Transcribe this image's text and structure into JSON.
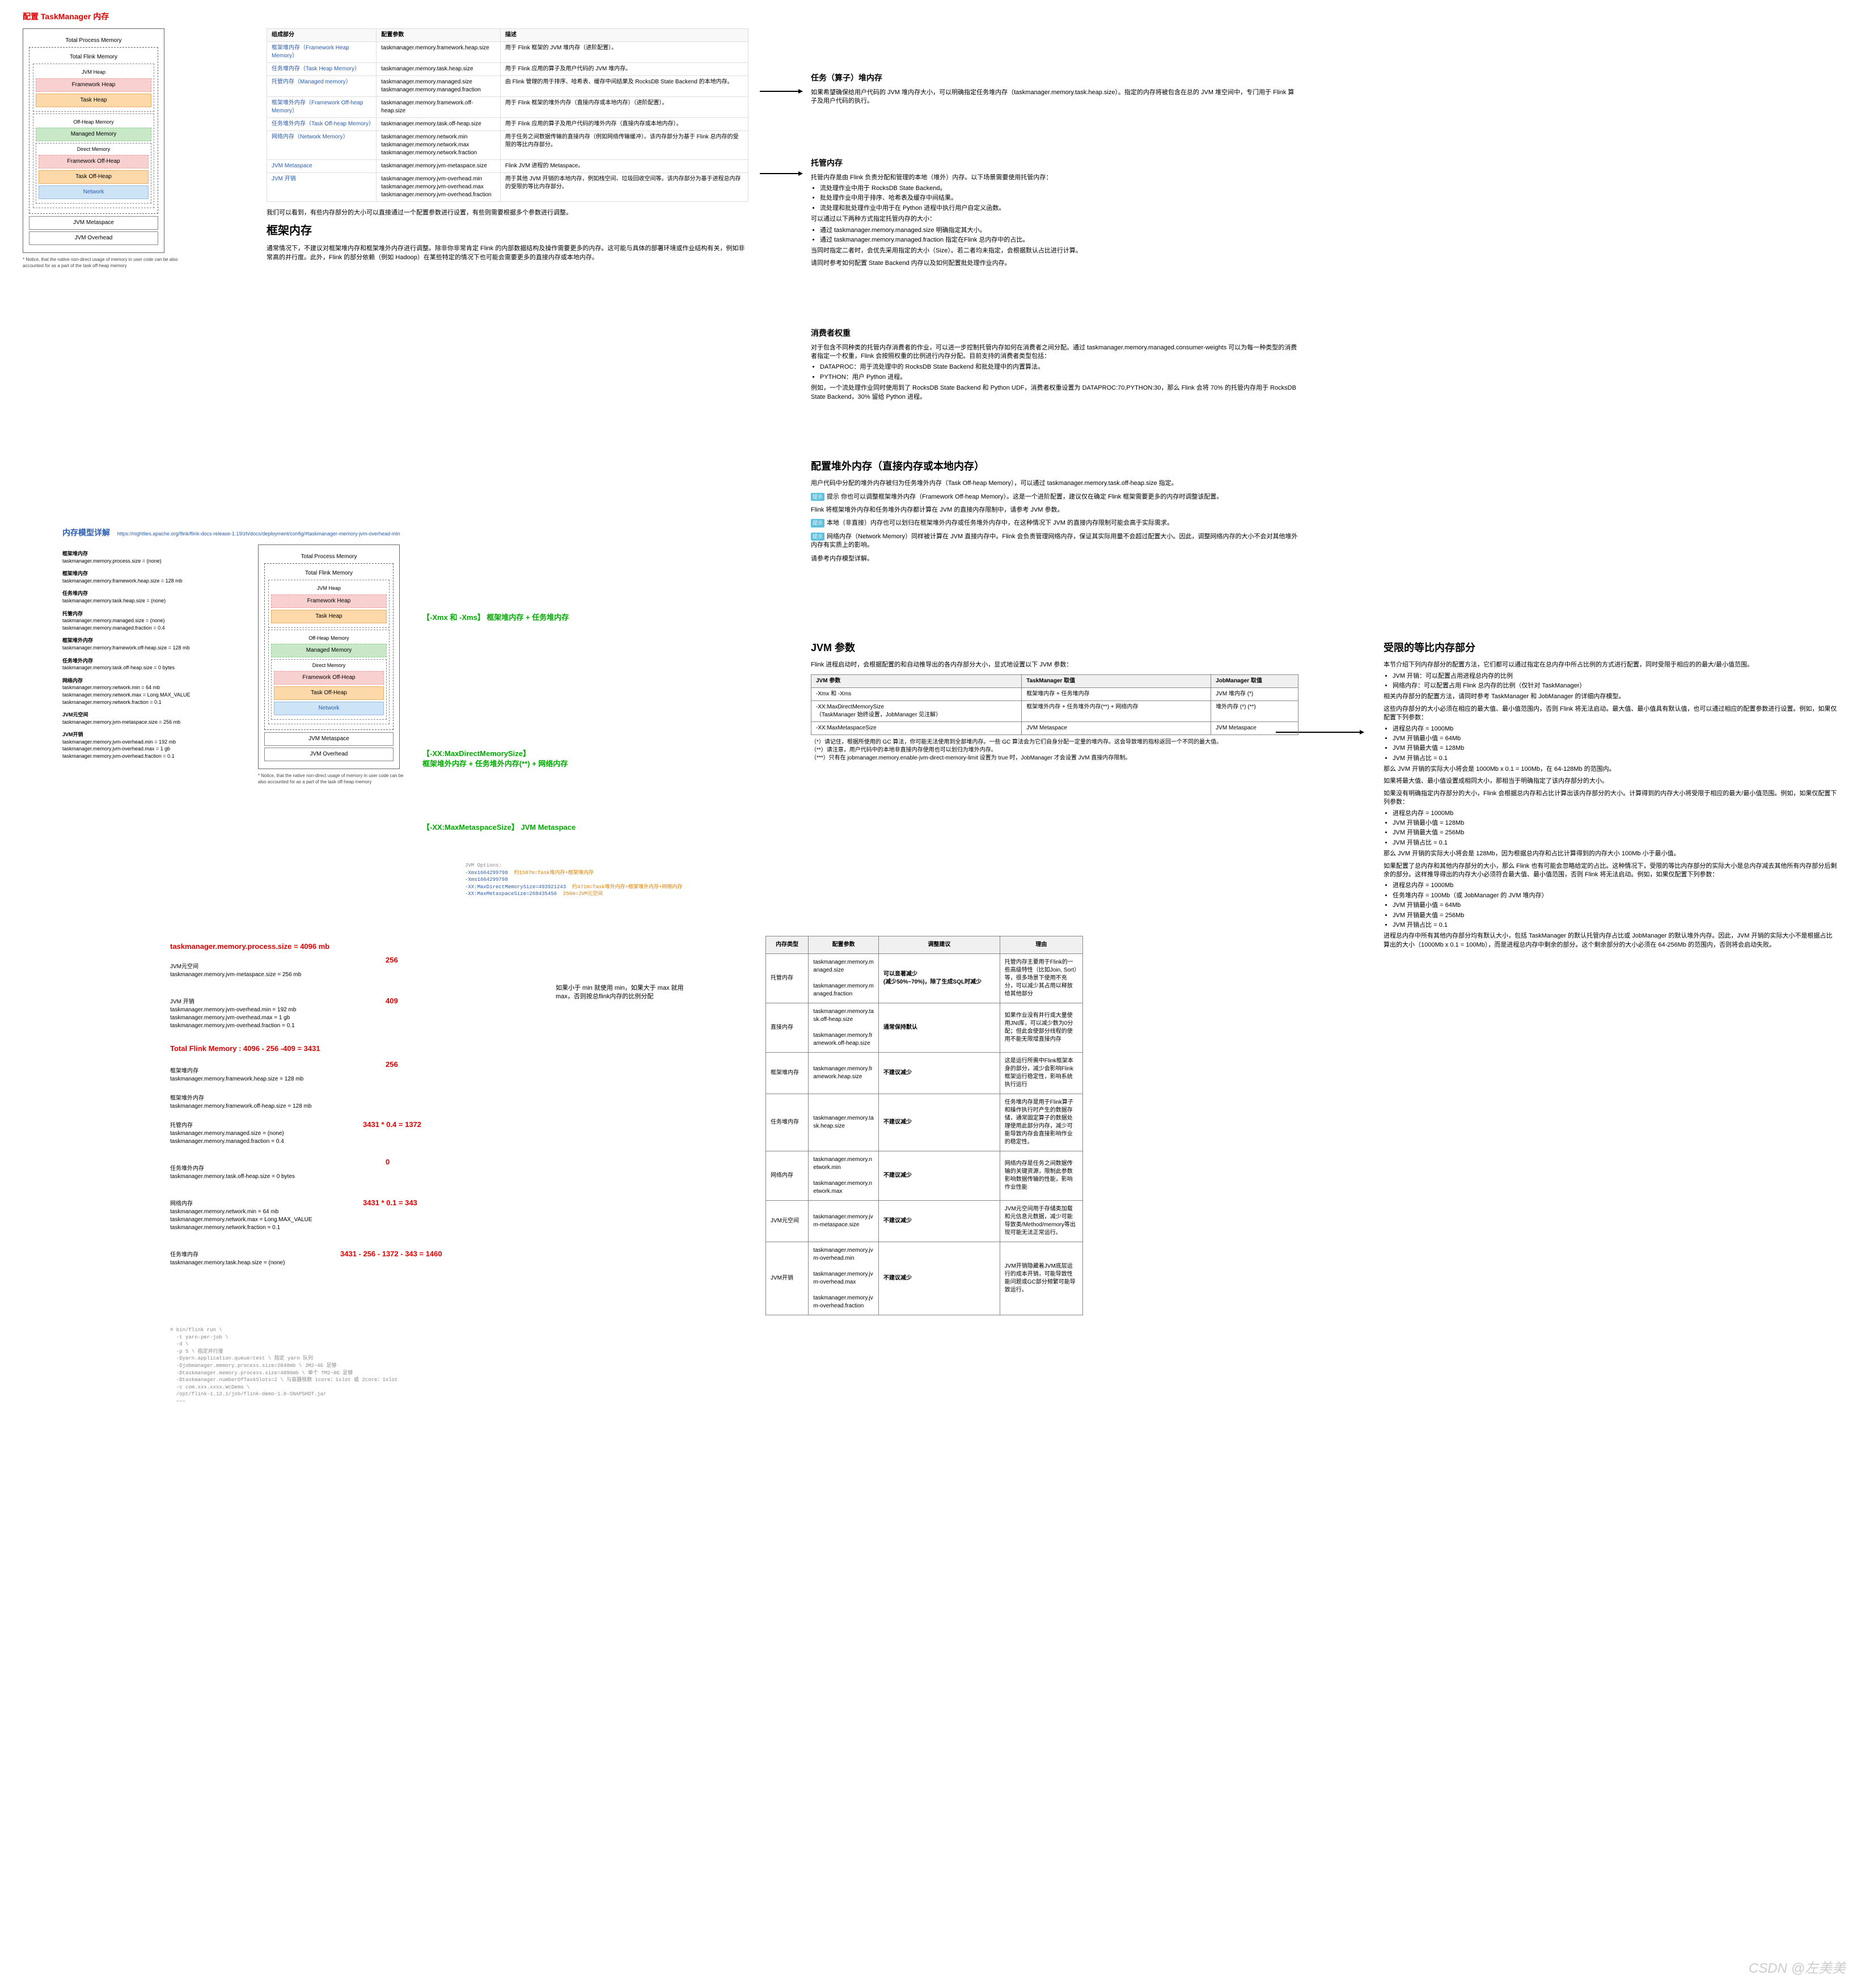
{
  "title": "配置 TaskManager 内存",
  "memdiagram": {
    "title": "Total Process Memory",
    "inner": "Total Flink Memory",
    "jvmheap_group": "JVM Heap",
    "fw_heap": "Framework Heap",
    "task_heap": "Task Heap",
    "offheap_group": "Off-Heap Memory",
    "managed": "Managed Memory",
    "direct_group": "Direct Memory",
    "fw_off": "Framework Off-Heap",
    "task_off": "Task Off-Heap",
    "network": "Network",
    "metaspace": "JVM Metaspace",
    "overhead": "JVM Overhead",
    "note": "* Notice, that the native non-direct usage of memory in user code can be also accounted for as a part of the task off-heap memory"
  },
  "table1": {
    "h1": "组成部分",
    "h2": "配置参数",
    "h3": "描述",
    "rows": [
      {
        "c1": "框架堆内存（Framework Heap Memory）",
        "c2": "taskmanager.memory.framework.heap.size",
        "c3": "用于 Flink 框架的 JVM 堆内存（进阶配置）。"
      },
      {
        "c1": "任务堆内存（Task Heap Memory）",
        "c2": "taskmanager.memory.task.heap.size",
        "c3": "用于 Flink 应用的算子及用户代码的 JVM 堆内存。"
      },
      {
        "c1": "托管内存（Managed memory）",
        "c2": "taskmanager.memory.managed.size\ntaskmanager.memory.managed.fraction",
        "c3": "由 Flink 管理的用于排序、哈希表、缓存中间结果及 RocksDB State Backend 的本地内存。"
      },
      {
        "c1": "框架堆外内存（Framework Off-heap Memory）",
        "c2": "taskmanager.memory.framework.off-heap.size",
        "c3": "用于 Flink 框架的堆外内存（直接内存或本地内存）（进阶配置）。"
      },
      {
        "c1": "任务堆外内存（Task Off-heap Memory）",
        "c2": "taskmanager.memory.task.off-heap.size",
        "c3": "用于 Flink 应用的算子及用户代码的堆外内存（直接内存或本地内存）。"
      },
      {
        "c1": "网络内存（Network Memory）",
        "c2": "taskmanager.memory.network.min\ntaskmanager.memory.network.max\ntaskmanager.memory.network.fraction",
        "c3": "用于任务之间数据传输的直接内存（例如网络传输缓冲）。该内存部分为基于 Flink 总内存的受限的等比内存部分。"
      },
      {
        "c1": "JVM Metaspace",
        "c2": "taskmanager.memory.jvm-metaspace.size",
        "c3": "Flink JVM 进程的 Metaspace。"
      },
      {
        "c1": "JVM 开销",
        "c2": "taskmanager.memory.jvm-overhead.min\ntaskmanager.memory.jvm-overhead.max\ntaskmanager.memory.jvm-overhead.fraction",
        "c3": "用于其他 JVM 开销的本地内存，例如栈空间、垃圾回收空间等。该内存部分为基于进程总内存的受限的等比内存部分。"
      }
    ],
    "footer": "我们可以看到，有些内存部分的大小可以直接通过一个配置参数进行设置，有些则需要根据多个参数进行调整。"
  },
  "framework_mem": {
    "title": "框架内存",
    "p1": "通常情况下，不建议对框架堆内存和框架堆外内存进行调整。除非你非常肯定 Flink 的内部数据结构及操作需要更多的内存。这可能与具体的部署环境或作业结构有关，例如非常高的并行度。此外，Flink 的部分依赖（例如 Hadoop）在某些特定的情况下也可能会需要更多的直接内存或本地内存。"
  },
  "task_heap": {
    "title": "任务（算子）堆内存",
    "p1": "如果希望确保给用户代码的 JVM 堆内存大小，可以明确指定任务堆内存（taskmanager.memory.task.heap.size）。指定的内存将被包含在总的 JVM 堆空间中，专门用于 Flink 算子及用户代码的执行。"
  },
  "managed": {
    "title": "托管内存",
    "p1": "托管内存是由 Flink 负责分配和管理的本地（堆外）内存。以下场景需要使用托管内存：",
    "b1": "流处理作业中用于 RocksDB State Backend。",
    "b2": "批处理作业中用于排序、哈希表及缓存中间结果。",
    "b3": "流处理和批处理作业中用于在 Python 进程中执行用户自定义函数。",
    "p2": "可以通过以下两种方式指定托管内存的大小：",
    "b4": "通过 taskmanager.memory.managed.size 明确指定其大小。",
    "b5": "通过 taskmanager.memory.managed.fraction 指定在Flink 总内存中的占比。",
    "p3": "当同时指定二者时，会优先采用指定的大小（Size）。若二者均未指定，会根据默认占比进行计算。",
    "p4": "请同时参考如何配置 State Backend 内存以及如何配置批处理作业内存。"
  },
  "consumer": {
    "title": "消费者权重",
    "p1": "对于包含不同种类的托管内存消费者的作业，可以进一步控制托管内存如何在消费者之间分配。通过 taskmanager.memory.managed.consumer-weights 可以为每一种类型的消费者指定一个权重，Flink 会按照权重的比例进行内存分配。目前支持的消费者类型包括：",
    "b1": "DATAPROC：用于流处理中的 RocksDB State Backend 和批处理中的内置算法。",
    "b2": "PYTHON：用户 Python 进程。",
    "p2": "例如，一个流处理作业同时使用到了 RocksDB State Backend 和 Python UDF，消费者权重设置为 DATAPROC:70,PYTHON:30，那么 Flink 会将 70% 的托管内存用于 RocksDB State Backend，30% 留给 Python 进程。"
  },
  "offheap_conf": {
    "title": "配置堆外内存（直接内存或本地内存）",
    "p1": "用户代码中分配的堆外内存被归为任务堆外内存（Task Off-heap Memory），可以通过 taskmanager.memory.task.off-heap.size 指定。",
    "p2": "提示 你也可以调整框架堆外内存（Framework Off-heap Memory）。这是一个进阶配置，建议仅在确定 Flink 框架需要更多的内存时调整该配置。",
    "p3": "Flink 将框架堆外内存和任务堆外内存都计算在 JVM 的直接内存限制中，请参考 JVM 参数。",
    "n1": "本地（非直接）内存也可以划归在框架堆外内存或任务堆外内存中，在这种情况下 JVM 的直接内存限制可能会高于实际需求。",
    "n2": "网络内存（Network Memory）同样被计算在 JVM 直接内存中。Flink 会负责管理网络内存，保证其实际用量不会超过配置大小。因此，调整网络内存的大小不会对其他堆外内存有实质上的影响。",
    "p4": "请参考内存模型详解。"
  },
  "jvm_params": {
    "title": "JVM 参数",
    "p1": "Flink 进程启动时，会根据配置的和自动推导出的各内存部分大小，显式地设置以下 JVM 参数：",
    "th1": "JVM 参数",
    "th2": "TaskManager 取值",
    "th3": "JobManager 取值",
    "r1": {
      "a": "-Xmx 和 -Xms",
      "b": "框架堆内存 + 任务堆内存",
      "c": "JVM 堆内存 (*)"
    },
    "r2": {
      "a": "-XX:MaxDirectMemorySize\n（TaskManager 始终设置，JobManager 见注解）",
      "b": "框架堆外内存 + 任务堆外内存(**) + 网络内存",
      "c": "堆外内存 (*) (**)"
    },
    "r3": {
      "a": "-XX:MaxMetaspaceSize",
      "b": "JVM Metaspace",
      "c": "JVM Metaspace"
    },
    "f1": "（*）请记住，根据所使用的 GC 算法，你可能无法使用到全部堆内存。一些 GC 算法会为它们自身分配一定量的堆内存。这会导致堆的指标返回一个不同的最大值。",
    "f2": "（**）请注意，用户代码中的本地非直接内存使用也可以划归为堆外内存。",
    "f3": "（***）只有在 jobmanager.memory.enable-jvm-direct-memory-limit 设置为 true 时，JobManager 才会设置 JVM 直接内存限制。"
  },
  "limited": {
    "title": "受限的等比内存部分",
    "p1": "本节介绍下列内存部分的配置方法，它们都可以通过指定在总内存中所占比例的方式进行配置，同时受限于相应的的最大/最小值范围。",
    "b1": "JVM 开销：可以配置占用进程总内存的比例",
    "b2": "网络内存：可以配置占用 Flink 总内存的比例（仅针对 TaskManager）",
    "p2": "相关内存部分的配置方法，请同时参考 TaskManager 和 JobManager 的详细内存模型。",
    "p3": "这些内存部分的大小必须在相应的最大值、最小值范围内，否则 Flink 将无法启动。最大值、最小值具有默认值，也可以通过相应的配置参数进行设置。例如，如果仅配置下列参数：",
    "e1_1": "进程总内存 = 1000Mb",
    "e1_2": "JVM 开销最小值 = 64Mb",
    "e1_3": "JVM 开销最大值 = 128Mb",
    "e1_4": "JVM 开销占比 = 0.1",
    "p4": "那么 JVM 开销的实际大小将会是 1000Mb x 0.1 = 100Mb，在 64-128Mb 的范围内。",
    "p5": "如果将最大值、最小值设置成相同大小，那相当于明确指定了该内存部分的大小。",
    "p6": "如果没有明确指定内存部分的大小，Flink 会根据总内存和占比计算出该内存部分的大小。计算得到的内存大小将受限于相应的最大/最小值范围。例如，如果仅配置下列参数：",
    "e2_1": "进程总内存 = 1000Mb",
    "e2_2": "JVM 开销最小值 = 128Mb",
    "e2_3": "JVM 开销最大值 = 256Mb",
    "e2_4": "JVM 开销占比 = 0.1",
    "p7": "那么 JVM 开销的实际大小将会是 128Mb，因为根据总内存和占比计算得到的内存大小 100Mb 小于最小值。",
    "p8": "如果配置了总内存和其他内存部分的大小，那么 Flink 也有可能会忽略给定的占比。这种情况下，受限的等比内存部分的实际大小是总内存减去其他所有内存部分后剩余的部分。这样推导得出的内存大小必须符合最大值、最小值范围，否则 Flink 将无法启动。例如，如果仅配置下列参数：",
    "e3_1": "进程总内存 = 1000Mb",
    "e3_2": "任务堆内存 = 100Mb（或 JobManager 的 JVM 堆内存）",
    "e3_3": "JVM 开销最小值 = 64Mb",
    "e3_4": "JVM 开销最大值 = 256Mb",
    "e3_5": "JVM 开销占比 = 0.1",
    "p9": "进程总内存中所有其他内存部分均有默认大小，包括 TaskManager 的默认托管内存占比或 JobManager 的默认堆外内存。因此，JVM 开销的实际大小不是根据占比算出的大小（1000Mb x 0.1 = 100Mb），而是进程总内存中剩余的部分。这个剩余部分的大小必须在 64-256Mb 的范围内，否则将会启动失败。"
  },
  "model_detail": {
    "title": "内存模型详解",
    "url": "https://nightlies.apache.org/flink/flink-docs-release-1.19/zh/docs/deployment/config/#taskmanager-memory-jvm-overhead-min",
    "s1": {
      "t": "框架堆内存",
      "v": "taskmanager.memory.process.size = (none)"
    },
    "s2": {
      "t": "框架堆内存",
      "v": "taskmanager.memory.framework.heap.size = 128 mb"
    },
    "s3": {
      "t": "任务堆内存",
      "v": "taskmanager.memory.task.heap.size = (none)"
    },
    "s4": {
      "t": "托管内存",
      "v": "taskmanager.memory.managed.size = (none)\ntaskmanager.memory.managed.fraction = 0.4"
    },
    "s5": {
      "t": "框架堆外内存",
      "v": "taskmanager.memory.framework.off-heap.size = 128 mb"
    },
    "s6": {
      "t": "任务堆外内存",
      "v": "taskmanager.memory.task.off-heap.size = 0 bytes"
    },
    "s7": {
      "t": "网络内存",
      "v": "taskmanager.memory.network.min = 64 mb\ntaskmanager.memory.network.max = Long.MAX_VALUE\ntaskmanager.memory.network.fraction = 0.1"
    },
    "s8": {
      "t": "JVM元空间",
      "v": "taskmanager.memory.jvm-metaspace.size = 256 mb"
    },
    "s9": {
      "t": "JVM开销",
      "v": "taskmanager.memory.jvm-overhead.min = 192 mb\ntaskmanager.memory.jvm-overhead.max = 1 gb\ntaskmanager.memory.jvm-overhead.fraction = 0.1"
    },
    "a1": "【-Xmx 和 -Xms】 框架堆内存 + 任务堆内存",
    "a2": "【-XX:MaxDirectMemorySize】\n框架堆外内存 + 任务堆外内存(**) + 网络内存",
    "a3": "【-XX:MaxMetaspaceSize】 JVM Metaspace",
    "jvmopt": "JVM Options:\n-Xmx1664299798  约1587m=Task堆内存+框架堆内存\n-Xms1664299798\n-XX:MaxDirectMemorySize=493921243  约471m=Task堆外内存+框架堆外内存+网络内存\n-XX:MaxMetaspaceSize=268435456  256m=JVM元空间"
  },
  "calc": {
    "l1": "taskmanager.memory.process.size = 4096 mb",
    "l2": "JVM元空间\ntaskmanager.memory.jvm-metaspace.size = 256 mb",
    "v2": "256",
    "l3": "JVM 开销\ntaskmanager.memory.jvm-overhead.min = 192 mb\ntaskmanager.memory.jvm-overhead.max = 1 gb\ntaskmanager.memory.jvm-overhead.fraction = 0.1",
    "v3": "409",
    "l4": "Total Flink Memory :  4096 - 256 -409 = 3431",
    "l5": "框架堆内存\ntaskmanager.memory.framework.heap.size = 128 mb",
    "v5": "256",
    "l6": "框架堆外内存\ntaskmanager.memory.framework.off-heap.size = 128 mb",
    "l7": "托管内存\ntaskmanager.memory.managed.size = (none)\ntaskmanager.memory.managed.fraction = 0.4",
    "v7": "3431 * 0.4 = 1372",
    "l8": "任务堆外内存\ntaskmanager.memory.task.off-heap.size = 0 bytes",
    "v8": "0",
    "l9": "网络内存\ntaskmanager.memory.network.min = 64 mb\ntaskmanager.memory.network.max = Long.MAX_VALUE\ntaskmanager.memory.network.fraction = 0.1",
    "v9": "3431 * 0.1 = 343",
    "l10": "任务堆内存\ntaskmanager.memory.task.heap.size = (none)",
    "v10": "3431 - 256 - 1372 - 343 = 1460"
  },
  "cli": "# bin/flink run \\\n  -t yarn-per-job \\\n  -d \\\n  -p 5 \\ 指定并行度\n  -Dyarn.application.queue=test \\ 指定 yarn 队列\n  -Djobmanager.memory.process.size=2048mb \\ JM2~4G 足够\n  -Dtaskmanager.memory.process.size=4096mb \\ 单个 TM2~8G 足够\n  -Dtaskmanager.numberOfTaskSlots=2 \\ 与容器核数 1core：1slot 或 2core：1slot\n  -c com.xxx.xxxx.WcDemo \\\n  /opt/flink-1.12.1/job/flink-demo-1.0-SNAPSHOT.jar\n  ~~~",
  "bigtable": {
    "h1": "内存类型",
    "h2": "配置参数",
    "h3": "调整建议",
    "h4": "理由",
    "r1": {
      "a": "托管内存",
      "b": "taskmanager.memory.managed.size\n\ntaskmanager.memory.managed.fraction",
      "c": "可以显著减少\n(减少50%~70%)，除了生成SQL时减少",
      "d": "托管内存主要用于Flink的一些高级特性（比如Join, Sort）等，很多场景下使用不充分，可以减少其占用以释放给其他部分"
    },
    "r2": {
      "a": "直接内存",
      "b": "taskmanager.memory.task.off-heap.size\n\ntaskmanager.memory.framework.off-heap.size",
      "c": "通常保持默认",
      "d": "如果作业没有并行或大量使用JNI库，可以减少数为0分配；但此会使部分线程的使用不能无限增直接内存"
    },
    "r3": {
      "a": "框架堆内存",
      "b": "taskmanager.memory.framework.heap.size",
      "c": "不建议减少",
      "d": "这是运行所需中Flink框架本身的部分，减少会影响Flink框架运行稳定性，影响系统执行运行"
    },
    "r4": {
      "a": "任务堆内存",
      "b": "taskmanager.memory.task.heap.size",
      "c": "不建议减少",
      "d": "任务堆内存是用于Flink算子和操作执行时产生的数据存储，通常固定算子的数据处理使用此部分内存，减少可能导致内存会直接影响作业的稳定性。"
    },
    "r5": {
      "a": "网络内存",
      "b": "taskmanager.memory.network.min\n\ntaskmanager.memory.network.max",
      "c": "不建议减少",
      "d": "网络内存是任务之间数据传输的关键资源，限制此参数影响数据传输的性能，影响作业性能"
    },
    "r6": {
      "a": "JVM元空间",
      "b": "taskmanager.memory.jvm-metaspace.size",
      "c": "不建议减少",
      "d": "JVM元空间用于存储类加载和元信息元数据，减少可能导致类/Method/memory等出现可能无法正常运行。"
    },
    "r7": {
      "a": "JVM开销",
      "b": "taskmanager.memory.jvm-overhead.min\n\ntaskmanager.memory.jvm-overhead.max\n\ntaskmanager.memory.jvm-overhead.fraction",
      "c": "不建议减少",
      "d": "JVM开销隐藏着JVM底层运行的成本开销，可能导致性能问题或GC部分频繁可能导致运行。"
    }
  },
  "minmax_note": "如果小于 min 就使用 min，如果大于 max 就用 max，否则按总flink内存的比例分配",
  "watermark": "CSDN @左美美"
}
